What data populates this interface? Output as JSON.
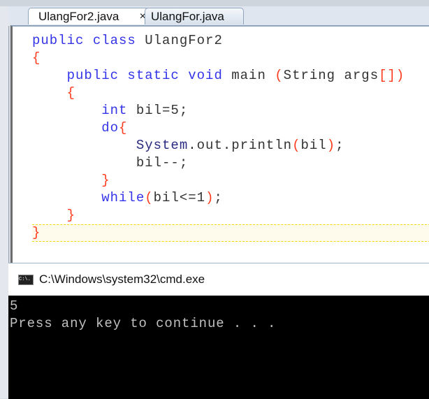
{
  "tabs": [
    {
      "label": "UlangFor2.java",
      "active": true,
      "close": "×"
    },
    {
      "label": "UlangFor.java",
      "active": false
    }
  ],
  "code": [
    [
      [
        "public class ",
        "kw"
      ],
      [
        "UlangFor2",
        "id"
      ]
    ],
    [
      [
        "{",
        "br"
      ]
    ],
    [
      [
        "    public static void ",
        "kw"
      ],
      [
        "main ",
        "id"
      ],
      [
        "(",
        "br"
      ],
      [
        "String args",
        "id"
      ],
      [
        "[]",
        "br"
      ],
      [
        ")",
        "br"
      ]
    ],
    [
      [
        "    {",
        "br"
      ]
    ],
    [
      [
        "        int ",
        "kw"
      ],
      [
        "bil=5;",
        "id"
      ]
    ],
    [
      [
        "        do",
        "kw"
      ],
      [
        "{",
        "br"
      ]
    ],
    [
      [
        "            System",
        "cls"
      ],
      [
        ".out.println",
        "id"
      ],
      [
        "(",
        "br"
      ],
      [
        "bil",
        "id"
      ],
      [
        ")",
        "br"
      ],
      [
        ";",
        "id"
      ]
    ],
    [
      [
        "            bil--;",
        "id"
      ]
    ],
    [
      [
        "        }",
        "br"
      ]
    ],
    [
      [
        "        while",
        "kw"
      ],
      [
        "(",
        "br"
      ],
      [
        "bil<=1",
        "id"
      ],
      [
        ")",
        "br"
      ],
      [
        ";",
        "id"
      ]
    ],
    [
      [
        "    }",
        "br"
      ]
    ],
    [
      [
        "}",
        "br"
      ]
    ]
  ],
  "cmd": {
    "title": "C:\\Windows\\system32\\cmd.exe",
    "icon": "cmd-icon",
    "icon_text": "C:\\.",
    "output": [
      "5",
      "Press any key to continue . . ."
    ]
  }
}
